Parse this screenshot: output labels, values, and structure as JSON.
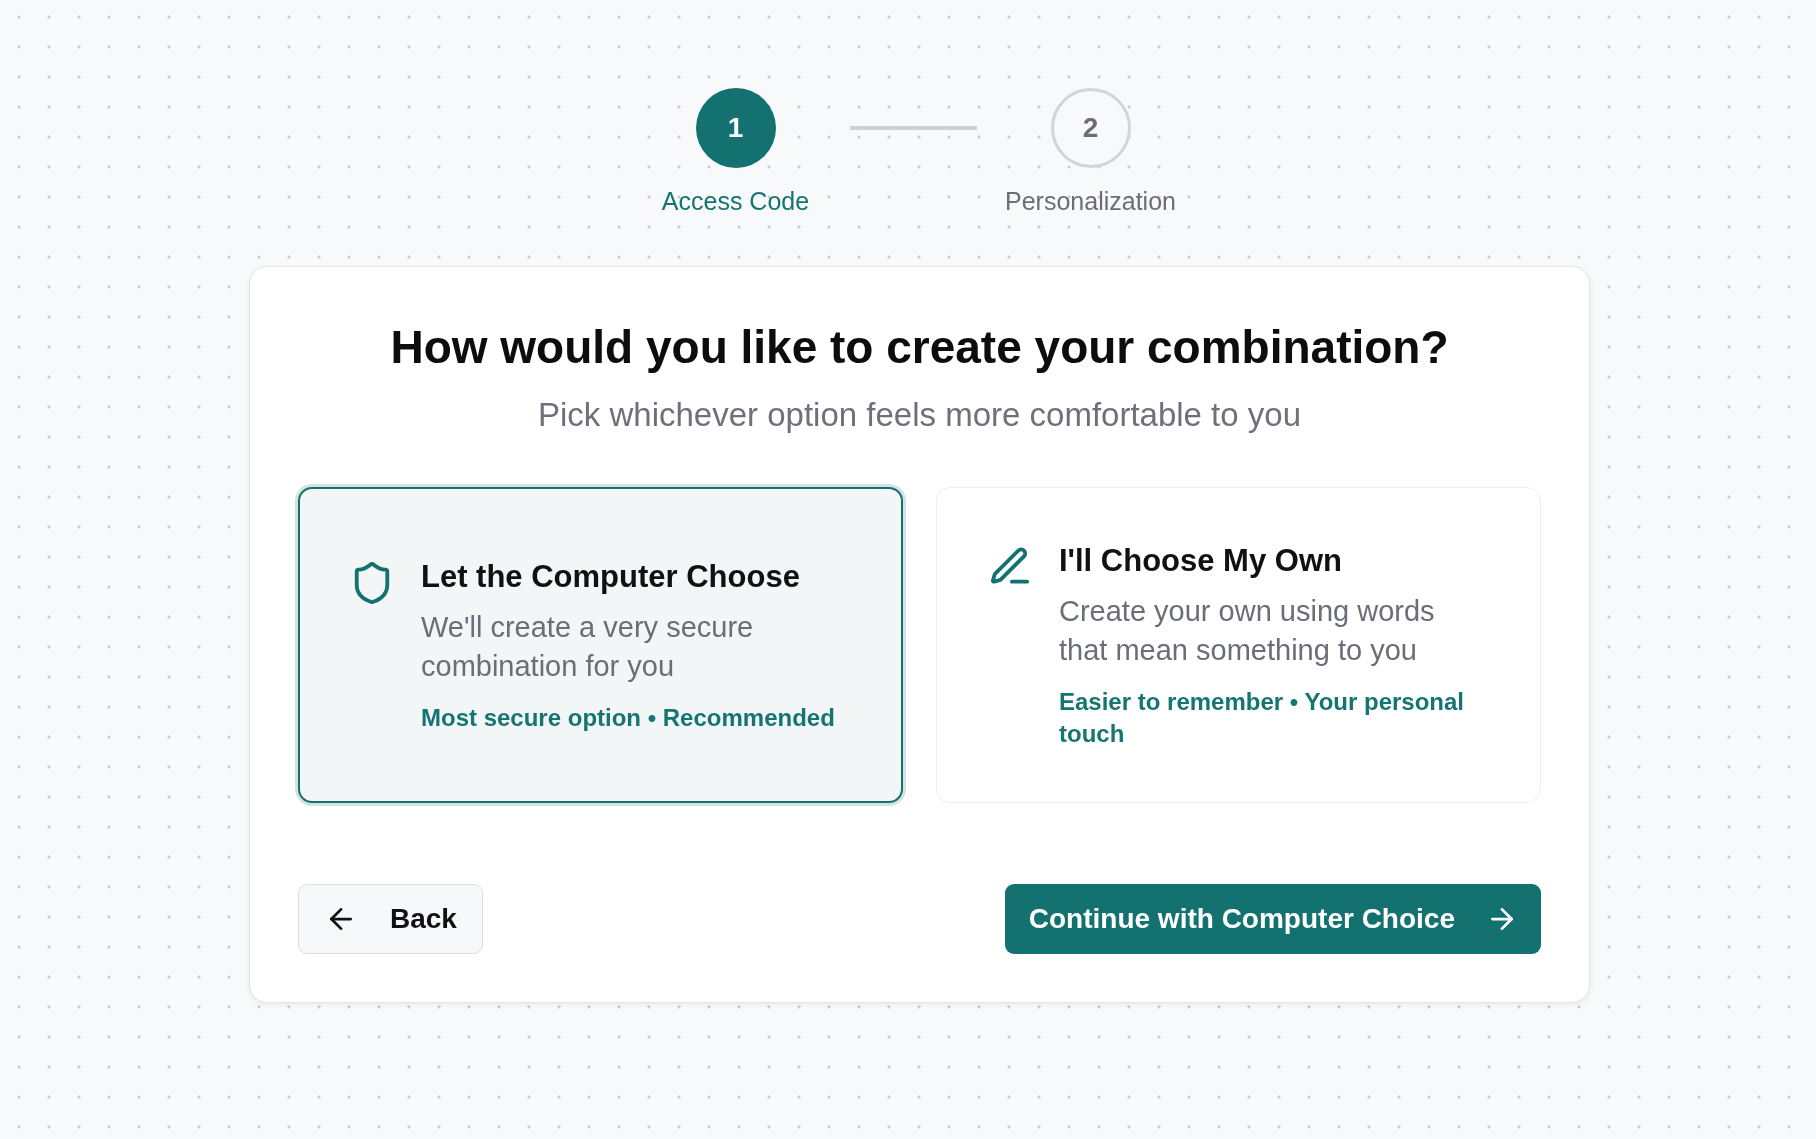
{
  "steps": [
    {
      "number": "1",
      "label": "Access Code",
      "selected": true
    },
    {
      "number": "2",
      "label": "Personalization",
      "selected": false
    }
  ],
  "card": {
    "title": "How would you like to create your combination?",
    "subtitle": "Pick whichever option feels more comfortable to you",
    "options": [
      {
        "kind": "generated",
        "title": "Let the Computer Choose",
        "description": "We'll create a very secure combination for you",
        "tags": "Most secure option • Recommended",
        "selected": true
      },
      {
        "kind": "custom",
        "title": "I'll Choose My Own",
        "description": "Create your own using words that mean something to you",
        "tags": "Easier to remember • Your personal touch",
        "selected": false
      }
    ],
    "back_button": {
      "label": "Back"
    },
    "continue_button": {
      "label": "Continue with Computer Choice"
    }
  }
}
